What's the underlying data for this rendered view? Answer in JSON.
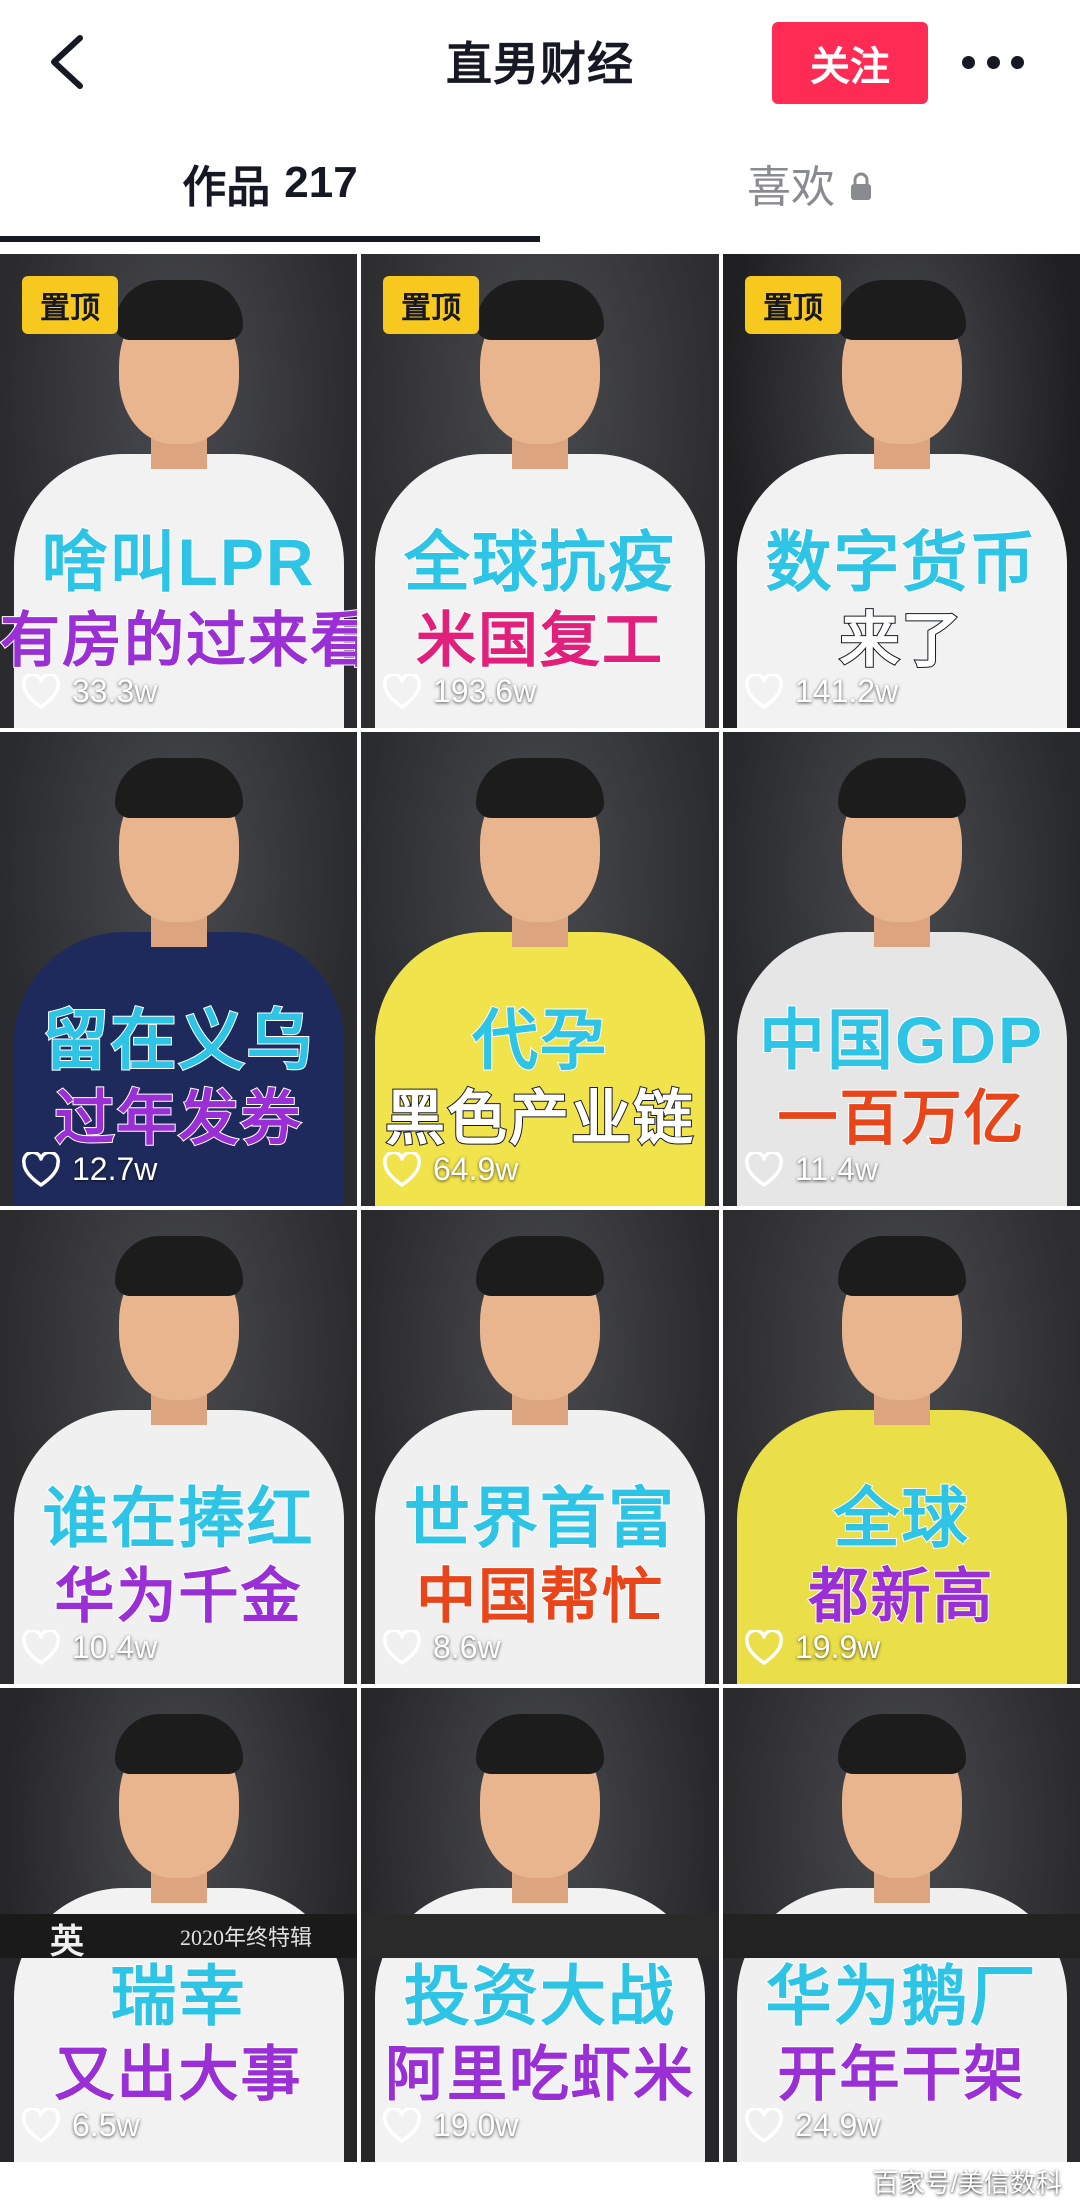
{
  "header": {
    "title": "直男财经",
    "follow_label": "关注",
    "back_icon": "chevron-left-icon",
    "more_icon": "more-horizontal-icon"
  },
  "tabs": {
    "works_label": "作品",
    "works_count": "217",
    "likes_label": "喜欢",
    "likes_icon": "lock-icon"
  },
  "colors": {
    "accent": "#fe2c55",
    "pin_badge": "#f7c81e",
    "caption_cyan": "#2ec4e6",
    "caption_purple": "#9b2fd6",
    "caption_orange": "#e8451a"
  },
  "videos": [
    {
      "pinned": true,
      "pin_label": "置顶",
      "line1": "啥叫LPR",
      "line2": "有房的过来看",
      "likes": "33.3w"
    },
    {
      "pinned": true,
      "pin_label": "置顶",
      "line1": "全球抗疫",
      "line2": "米国复工",
      "likes": "193.6w"
    },
    {
      "pinned": true,
      "pin_label": "置顶",
      "line1": "数字货币",
      "line2": "来了",
      "likes": "141.2w"
    },
    {
      "pinned": false,
      "line1": "留在义乌",
      "line2": "过年发券",
      "likes": "12.7w"
    },
    {
      "pinned": false,
      "line1": "代孕",
      "line2": "黑色产业链",
      "likes": "64.9w"
    },
    {
      "pinned": false,
      "line1": "中国GDP",
      "line2": "一百万亿",
      "likes": "11.4w"
    },
    {
      "pinned": false,
      "line1": "谁在捧红",
      "line2": "华为千金",
      "likes": "10.4w"
    },
    {
      "pinned": false,
      "line1": "世界首富",
      "line2": "中国帮忙",
      "likes": "8.6w"
    },
    {
      "pinned": false,
      "line1": "全球",
      "line2": "都新高",
      "likes": "19.9w"
    },
    {
      "pinned": false,
      "line1": "瑞幸",
      "line2": "又出大事",
      "likes": "6.5w"
    },
    {
      "pinned": false,
      "line1": "投资大战",
      "line2": "阿里吃虾米",
      "likes": "19.0w"
    },
    {
      "pinned": false,
      "line1": "华为鹅厂",
      "line2": "开年干架",
      "likes": "24.9w"
    }
  ],
  "partial_row": {
    "logo": "英",
    "text": "2020年终特辑"
  },
  "watermark": "百家号/美信数科"
}
